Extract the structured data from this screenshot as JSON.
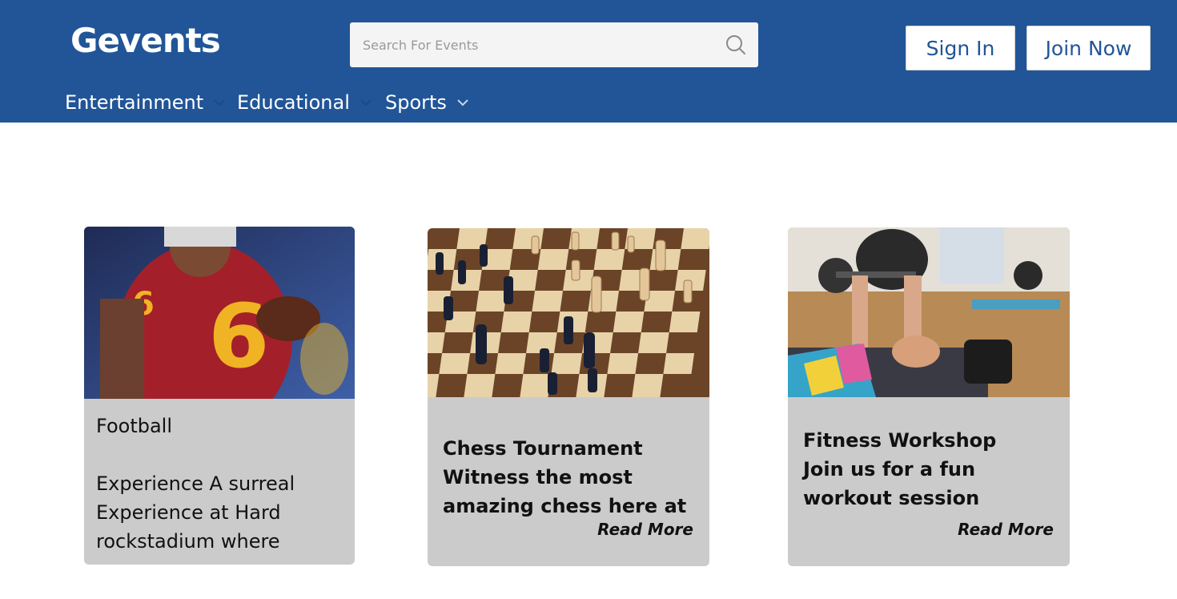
{
  "header": {
    "logo": "Gevents",
    "search_placeholder": "Search For Events",
    "sign_in": "Sign In",
    "join_now": "Join Now",
    "nav": [
      {
        "label": "Entertainment"
      },
      {
        "label": "Educational"
      },
      {
        "label": "Sports"
      }
    ]
  },
  "cards": [
    {
      "title": "Football",
      "description": "Experience A surreal Experience at Hard rockstadium where",
      "image": "football-player-photo"
    },
    {
      "title": "Chess Tournament",
      "description": "Witness the most amazing chess here at",
      "read_more": "Read More",
      "image": "chess-board-photo"
    },
    {
      "title": "Fitness Workshop",
      "description": "Join us for a fun workout session",
      "read_more": "Read More",
      "image": "fitness-class-photo"
    }
  ],
  "colors": {
    "header_bg": "#215597",
    "card_bg": "#cbcbcb",
    "button_text": "#215597"
  }
}
